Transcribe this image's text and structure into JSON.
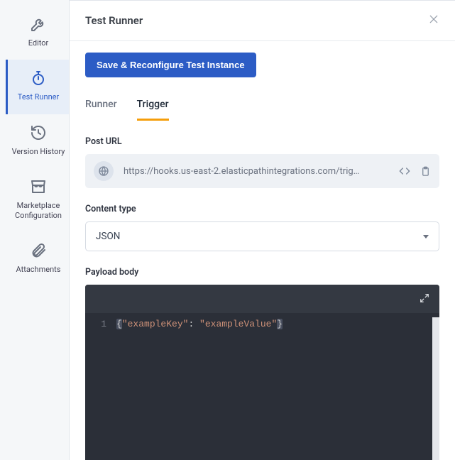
{
  "sidebar": {
    "items": [
      {
        "label": "Editor"
      },
      {
        "label": "Test Runner"
      },
      {
        "label": "Version History"
      },
      {
        "label": "Marketplace Configuration"
      },
      {
        "label": "Attachments"
      }
    ]
  },
  "header": {
    "title": "Test Runner"
  },
  "actions": {
    "save": "Save & Reconfigure Test Instance"
  },
  "tabs": [
    {
      "label": "Runner"
    },
    {
      "label": "Trigger"
    }
  ],
  "postUrl": {
    "label": "Post URL",
    "value": "https://hooks.us-east-2.elasticpathintegrations.com/trig…"
  },
  "contentType": {
    "label": "Content type",
    "selected": "JSON"
  },
  "payload": {
    "label": "Payload body",
    "lineNumber": "1",
    "braceOpen": "{",
    "key": "\"exampleKey\"",
    "colon": ": ",
    "value": "\"exampleValue\"",
    "braceClose": "}"
  }
}
